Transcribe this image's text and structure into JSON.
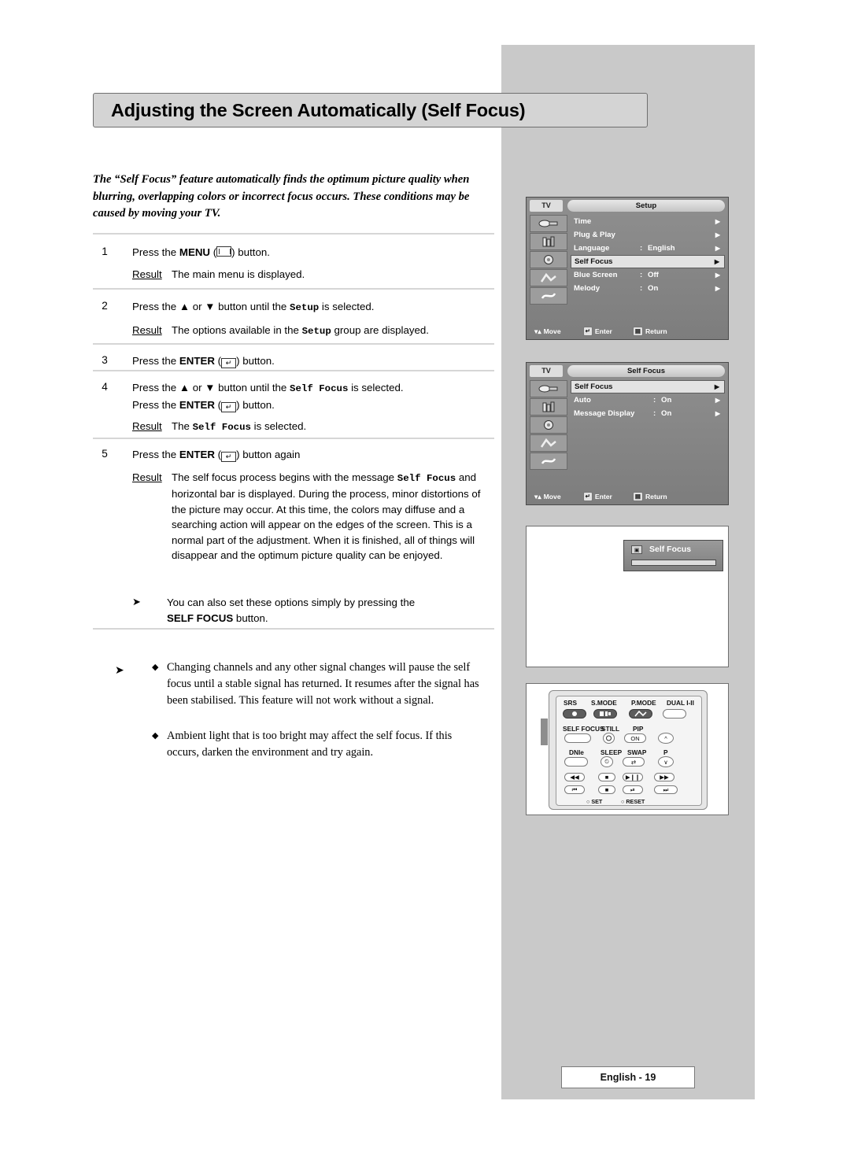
{
  "page": {
    "title": "Adjusting the Screen Automatically (Self Focus)",
    "intro": "The “Self Focus” feature automatically finds the optimum picture quality when blurring, overlapping colors or incorrect focus occurs. These conditions may be caused by moving your TV.",
    "footer": "English - 19"
  },
  "steps": [
    {
      "num": "1",
      "lines": [
        "Press the MENU (▤) button."
      ],
      "result_label": "Result",
      "result": "The main menu is displayed."
    },
    {
      "num": "2",
      "lines": [
        "Press the ▲ or ▼ button until the Setup is selected."
      ],
      "result_label": "Result",
      "result": "The options available in the Setup group are displayed."
    },
    {
      "num": "3",
      "lines": [
        "Press the ENTER (↵) button."
      ],
      "result_label": "",
      "result": ""
    },
    {
      "num": "4",
      "lines": [
        "Press the ▲ or ▼ button until the Self Focus is selected.",
        "Press the ENTER (↵) button."
      ],
      "result_label": "Result",
      "result": "The Self Focus is selected."
    },
    {
      "num": "5",
      "lines": [
        "Press the ENTER (↵) button again"
      ],
      "result_label": "Result",
      "result": "The self focus process begins with the message Self Focus and horizontal bar is displayed. During the process, minor distortions of the picture may occur. At this time, the colors may diffuse and a searching action will appear on the edges of the screen. This is a normal part of the adjustment. When it is finished, all of things will disappear and the optimum picture quality can be enjoyed."
    }
  ],
  "notes": {
    "tip": "You can also set these options simply by pressing the",
    "tip_bold": "SELF FOCUS",
    "tip_tail": "button.",
    "bullets": [
      "Changing channels and any other signal changes will pause the self focus until a stable signal has returned. It resumes after the signal has been stabilised. This feature will not work without a signal.",
      "Ambient light that is too bright may affect the self focus. If this occurs, darken the environment and try again."
    ]
  },
  "osd_setup": {
    "tv_tab": "TV",
    "title": "Setup",
    "footer": {
      "move": "Move",
      "enter": "Enter",
      "return": "Return"
    },
    "rows": [
      {
        "label": "Time",
        "colon": "",
        "value": "",
        "arrow": "▶",
        "highlight": false
      },
      {
        "label": "Plug & Play",
        "colon": "",
        "value": "",
        "arrow": "▶",
        "highlight": false
      },
      {
        "label": "Language",
        "colon": ":",
        "value": "English",
        "arrow": "▶",
        "highlight": false
      },
      {
        "label": "Self Focus",
        "colon": "",
        "value": "",
        "arrow": "▶",
        "highlight": true
      },
      {
        "label": "Blue Screen",
        "colon": ":",
        "value": "Off",
        "arrow": "▶",
        "highlight": false
      },
      {
        "label": "Melody",
        "colon": ":",
        "value": "On",
        "arrow": "▶",
        "highlight": false
      }
    ]
  },
  "osd_selffocus": {
    "tv_tab": "TV",
    "title": "Self Focus",
    "footer": {
      "move": "Move",
      "enter": "Enter",
      "return": "Return"
    },
    "rows": [
      {
        "label": "Self Focus",
        "colon": "",
        "value": "",
        "arrow": "▶",
        "highlight": true
      },
      {
        "label": "Auto",
        "colon": ":",
        "value": "On",
        "arrow": "▶",
        "highlight": false
      },
      {
        "label": "Message Display",
        "colon": ":",
        "value": "On",
        "arrow": "▶",
        "highlight": false
      }
    ]
  },
  "progress_panel": {
    "label": "Self Focus"
  },
  "remote": {
    "top_labels": [
      "SRS",
      "S.MODE",
      "P.MODE",
      "DUAL I-II"
    ],
    "row2_labels": [
      "SELF FOCUS",
      "STILL",
      "PIP"
    ],
    "row3_labels": [
      "DNIe",
      "SLEEP",
      "SWAP",
      "P"
    ],
    "bottom_labels": [
      "SET",
      "RESET"
    ],
    "pip_button": "ON"
  }
}
